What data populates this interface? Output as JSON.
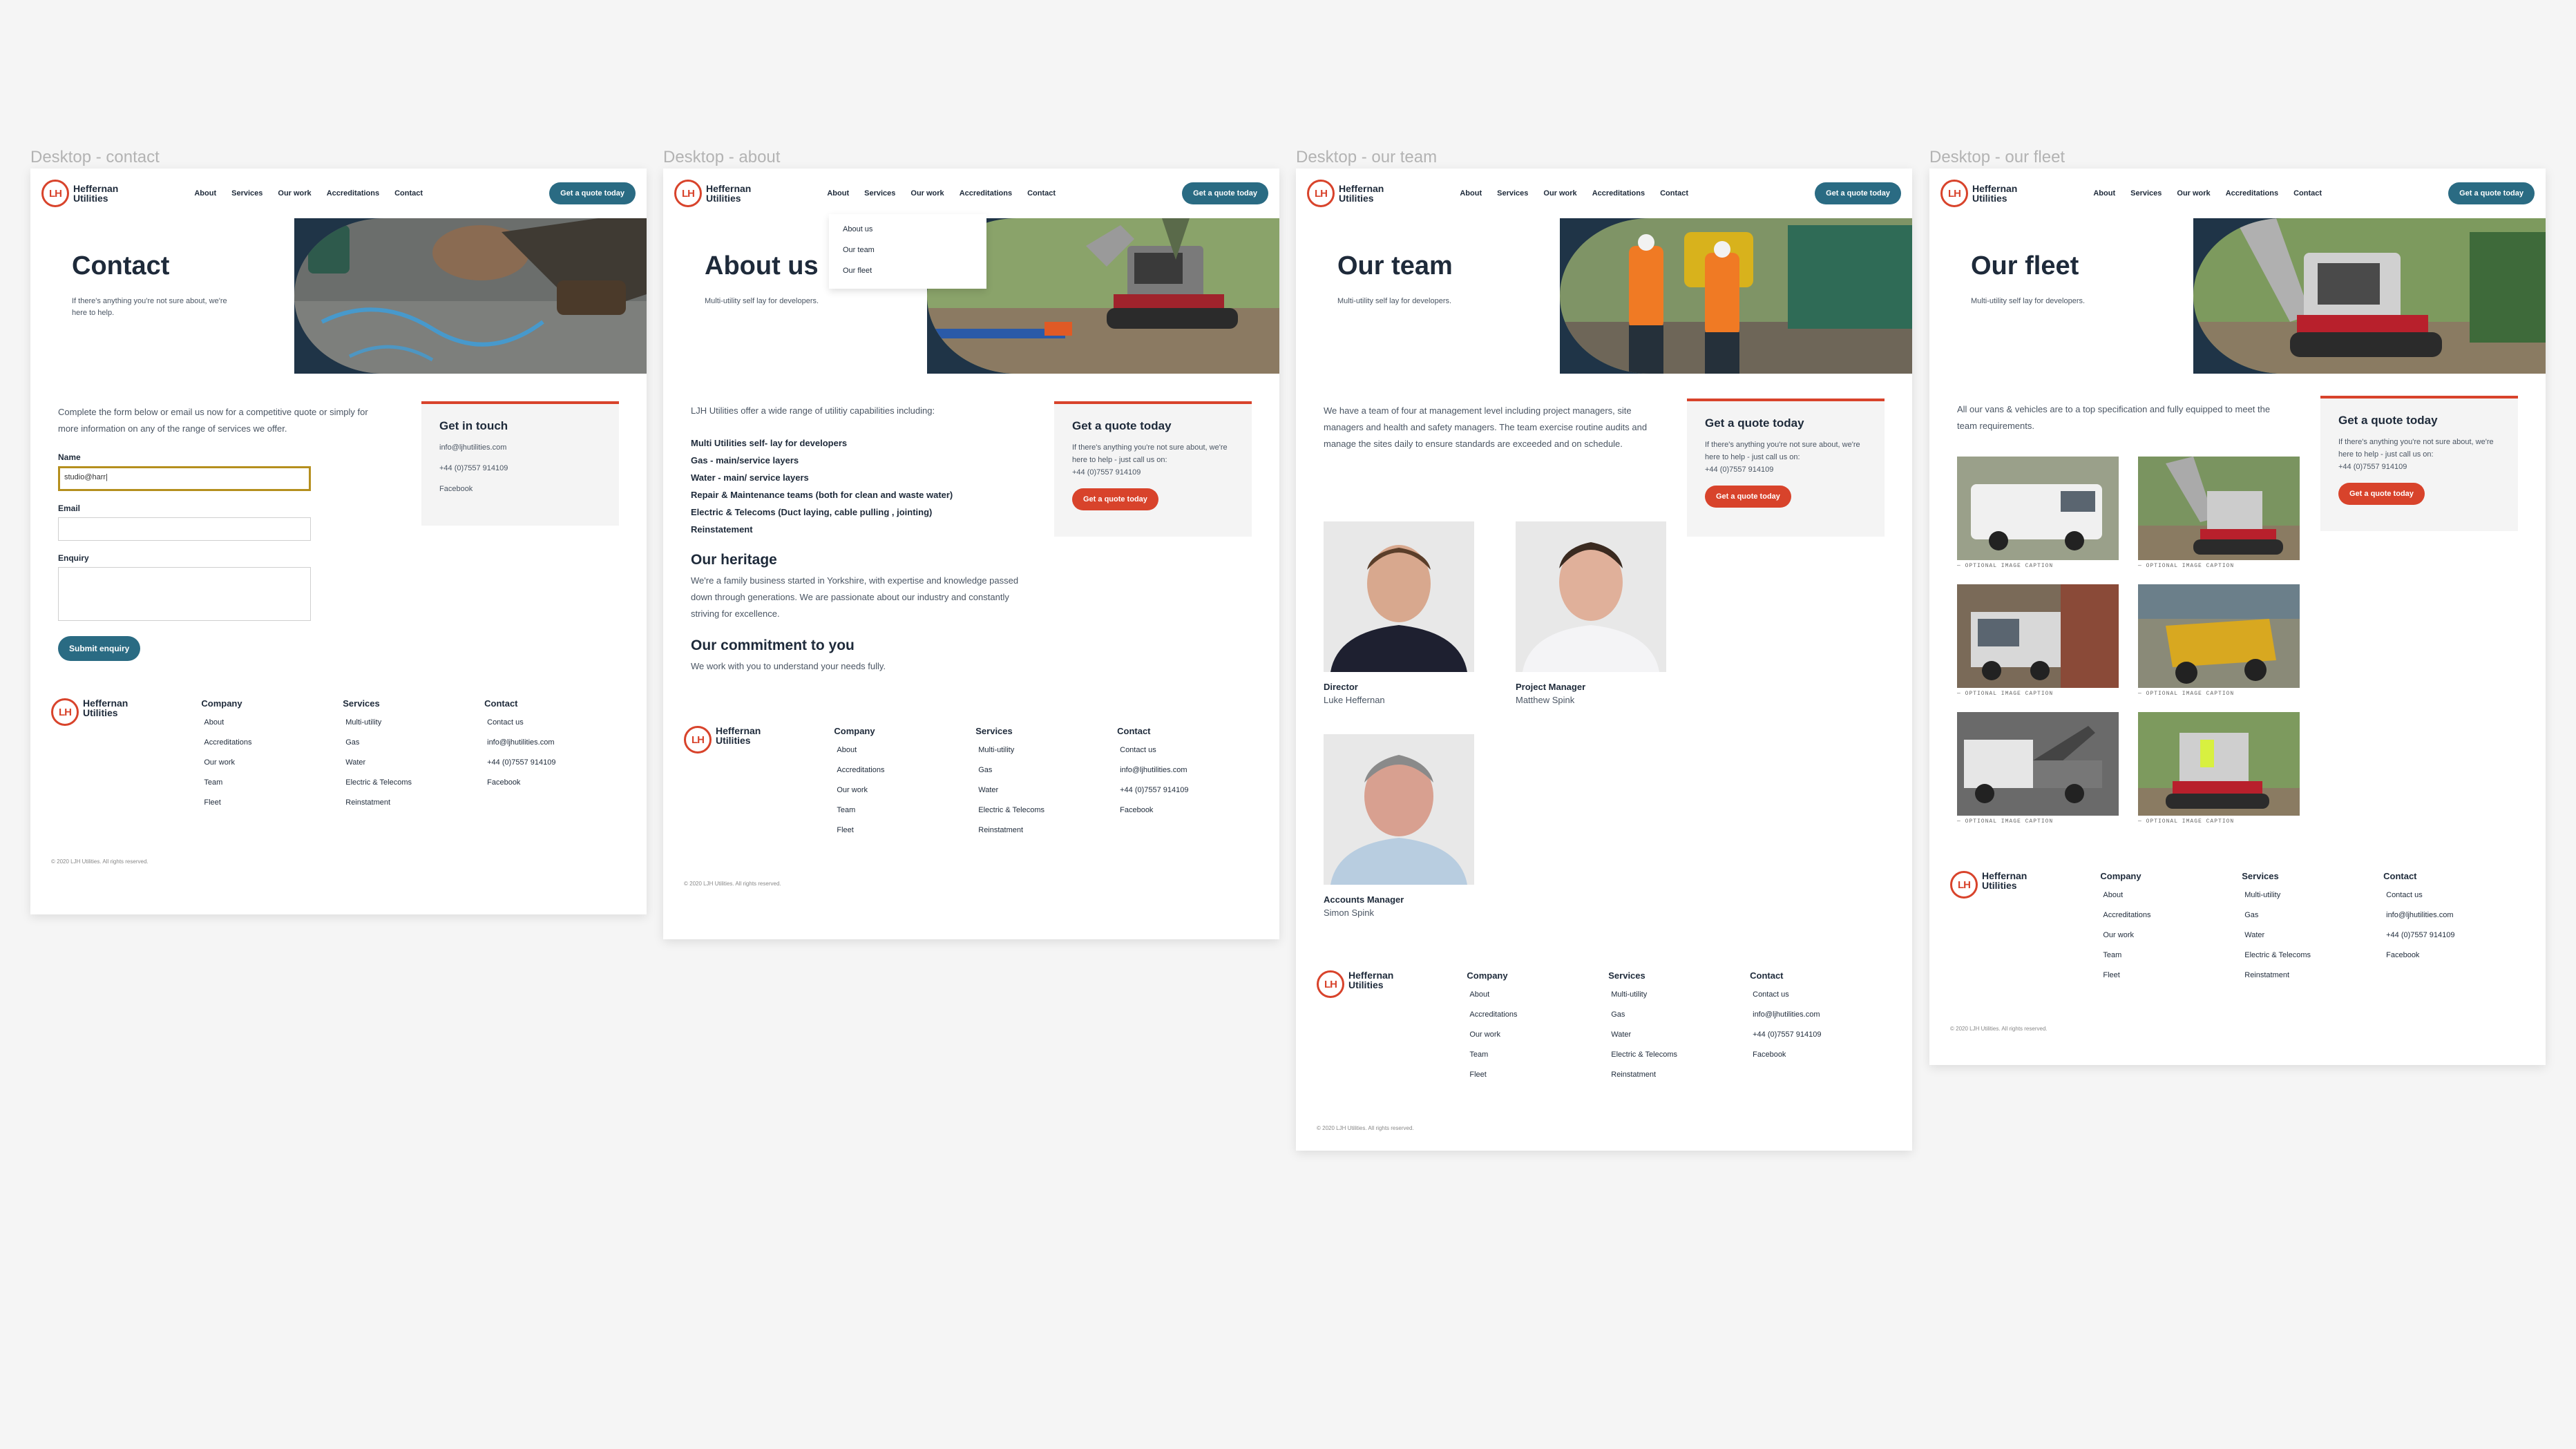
{
  "canvas": {
    "background": "#f5f5f5"
  },
  "colors": {
    "navy": "#1e2a3a",
    "teal": "#2a6b83",
    "red": "#d8432b",
    "card": "#f4f4f4"
  },
  "brand": {
    "name_line1": "Heffernan",
    "name_line2": "Utilities",
    "mark": "LH"
  },
  "nav": {
    "about": "About",
    "services": "Services",
    "our_work": "Our work",
    "accreditations": "Accreditations",
    "contact": "Contact",
    "cta": "Get a quote today"
  },
  "frames": {
    "contact": {
      "label": "Desktop - contact",
      "title": "Contact",
      "subtitle": "If there's anything you're not sure about, we're here to help.",
      "intro": "Complete the form below or email us now for a competitive quote or simply for more information on any of the range of services we offer.",
      "form": {
        "name_label": "Name",
        "name_value": "studio@harr|",
        "email_label": "Email",
        "enquiry_label": "Enquiry",
        "submit": "Submit enquiry"
      },
      "card": {
        "title": "Get in touch",
        "email": "info@ljhutilities.com",
        "phone": "+44 (0)7557 914109",
        "facebook": "Facebook"
      }
    },
    "about": {
      "label": "Desktop - about",
      "title": "About us",
      "subtitle": "Multi-utility self lay for developers.",
      "dropdown": [
        "About us",
        "Our team",
        "Our fleet"
      ],
      "intro": "LJH Utilities offer a wide range of utilitiy capabilities including:",
      "capabilities": [
        "Multi Utilities self- lay for developers",
        "Gas - main/service layers",
        "Water - main/ service layers",
        "Repair & Maintenance teams (both for clean and waste water)",
        "Electric & Telecoms  (Duct laying, cable pulling , jointing)",
        "Reinstatement"
      ],
      "heritage_title": "Our heritage",
      "heritage_text": "We're a family business started in Yorkshire, with expertise and knowledge passed down through generations. We are passionate about our industry and constantly striving for excellence.",
      "commitment_title": "Our commitment to you",
      "commitment_text": "We work with you to understand your needs fully.",
      "card": {
        "title": "Get a quote today",
        "text": "If there's anything you're not sure about, we're here to help - just call us on:",
        "phone": "+44 (0)7557 914109",
        "button": "Get a quote today"
      }
    },
    "team": {
      "label": "Desktop - our team",
      "title": "Our team",
      "subtitle": "Multi-utility self lay for developers.",
      "intro": "We have a team of four at management level including project managers, site managers and health and safety managers. The team exercise routine audits and manage the sites daily to ensure standards are exceeded and on schedule.",
      "members": [
        {
          "role": "Director",
          "name": "Luke Heffernan"
        },
        {
          "role": "Project Manager",
          "name": "Matthew Spink"
        },
        {
          "role": "Accounts Manager",
          "name": "Simon Spink"
        }
      ],
      "card": {
        "title": "Get a quote today",
        "text": "If there's anything you're not sure about, we're here to help - just call us on:",
        "phone": "+44 (0)7557 914109",
        "button": "Get a quote today"
      }
    },
    "fleet": {
      "label": "Desktop - our fleet",
      "title": "Our fleet",
      "subtitle": "Multi-utility self lay for developers.",
      "intro": "All our vans & vehicles are to a top specification and fully equipped to meet the team requirements.",
      "caption": "— OPTIONAL IMAGE CAPTION",
      "card": {
        "title": "Get a quote today",
        "text": "If there's anything you're not sure about, we're here to help - just call us on:",
        "phone": "+44 (0)7557 914109",
        "button": "Get a quote today"
      }
    }
  },
  "footer": {
    "company_title": "Company",
    "company": [
      "About",
      "Accreditations",
      "Our work",
      "Team",
      "Fleet"
    ],
    "services_title": "Services",
    "services": [
      "Multi-utility",
      "Gas",
      "Water",
      "Electric & Telecoms",
      "Reinstatment"
    ],
    "contact_title": "Contact",
    "contact": [
      "Contact us",
      "info@ljhutilities.com",
      "+44 (0)7557 914109",
      "Facebook"
    ],
    "copyright": "© 2020 LJH Utilities. All rights reserved."
  }
}
